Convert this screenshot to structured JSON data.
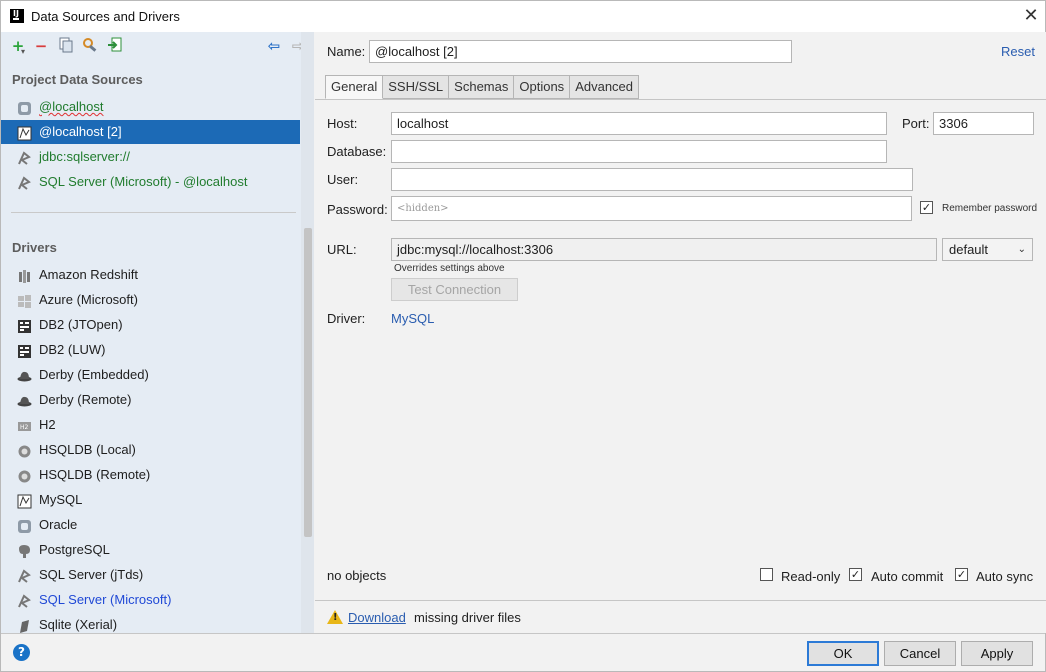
{
  "window": {
    "title": "Data Sources and Drivers",
    "app_icon_text": "IJ"
  },
  "sidebar": {
    "project_section_title": "Project Data Sources",
    "data_sources": [
      {
        "label": "@localhost",
        "icon": "database-icon",
        "color": "#217c2e"
      },
      {
        "label": "@localhost [2]",
        "icon": "mysql-icon",
        "selected": true
      },
      {
        "label": "jdbc:sqlserver://",
        "icon": "sqlserver-icon",
        "color": "#217c2e"
      },
      {
        "label": "SQL Server (Microsoft) - @localhost",
        "icon": "sqlserver-icon",
        "color": "#217c2e"
      }
    ],
    "drivers_section_title": "Drivers",
    "drivers": [
      {
        "label": "Amazon Redshift",
        "icon": "redshift-icon"
      },
      {
        "label": "Azure (Microsoft)",
        "icon": "azure-icon"
      },
      {
        "label": "DB2 (JTOpen)",
        "icon": "db2-icon"
      },
      {
        "label": "DB2 (LUW)",
        "icon": "db2-icon"
      },
      {
        "label": "Derby (Embedded)",
        "icon": "derby-hat-icon"
      },
      {
        "label": "Derby (Remote)",
        "icon": "derby-hat-icon"
      },
      {
        "label": "H2",
        "icon": "h2-icon"
      },
      {
        "label": "HSQLDB (Local)",
        "icon": "hsqldb-icon"
      },
      {
        "label": "HSQLDB (Remote)",
        "icon": "hsqldb-icon"
      },
      {
        "label": "MySQL",
        "icon": "mysql-icon"
      },
      {
        "label": "Oracle",
        "icon": "oracle-icon"
      },
      {
        "label": "PostgreSQL",
        "icon": "postgresql-elephant-icon"
      },
      {
        "label": "SQL Server (jTds)",
        "icon": "sqlserver-icon"
      },
      {
        "label": "SQL Server (Microsoft)",
        "icon": "sqlserver-icon",
        "color": "#2049d6"
      },
      {
        "label": "Sqlite (Xerial)",
        "icon": "sqlite-icon"
      }
    ]
  },
  "form": {
    "name_label": "Name:",
    "name_value": "@localhost [2]",
    "reset_label": "Reset",
    "tabs": [
      "General",
      "SSH/SSL",
      "Schemas",
      "Options",
      "Advanced"
    ],
    "active_tab": "General",
    "host_label": "Host:",
    "host_value": "localhost",
    "port_label": "Port:",
    "port_value": "3306",
    "database_label": "Database:",
    "database_value": "",
    "user_label": "User:",
    "user_value": "",
    "password_label": "Password:",
    "password_placeholder": "<hidden>",
    "remember_password_label": "Remember password",
    "remember_password_checked": true,
    "url_label": "URL:",
    "url_value": "jdbc:mysql://localhost:3306",
    "url_mode": "default",
    "url_hint": "Overrides settings above",
    "test_connection_label": "Test Connection",
    "driver_label": "Driver:",
    "driver_value": "MySQL",
    "objects_status": "no objects",
    "read_only_label": "Read-only",
    "read_only_checked": false,
    "auto_commit_label": "Auto commit",
    "auto_commit_checked": true,
    "auto_sync_label": "Auto sync",
    "auto_sync_checked": true,
    "warning_link": "Download",
    "warning_text": "missing driver files"
  },
  "buttons": {
    "ok": "OK",
    "cancel": "Cancel",
    "apply": "Apply",
    "help": "?"
  },
  "colors": {
    "selection": "#1c6ab6",
    "link": "#2a5db0",
    "green_text": "#217c2e",
    "warning": "#e8b617"
  }
}
